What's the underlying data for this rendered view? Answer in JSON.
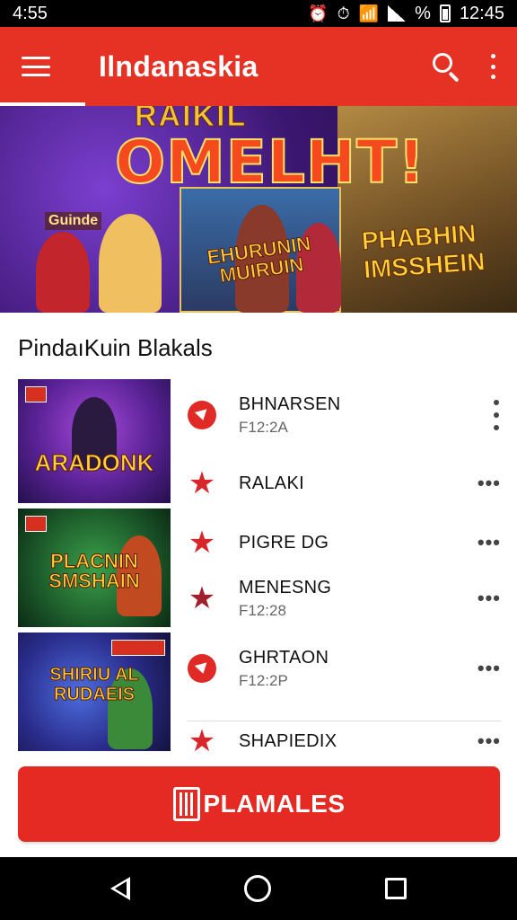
{
  "status_bar": {
    "time_left": "4:55",
    "battery_percent": "%",
    "time_right": "12:45",
    "icons": [
      "alarm-icon",
      "alarm-icon",
      "wifi-icon",
      "signal-icon",
      "battery-icon"
    ]
  },
  "app_bar": {
    "title": "Ilndanaskia",
    "menu_icon": "menu-icon",
    "search_icon": "search-icon",
    "more_icon": "more-vert-icon"
  },
  "banner": {
    "top_text": "RAIKIL",
    "title": "OMELHT!",
    "left_tag": "Guinde",
    "mid_text": "EHURUNIN\nMUIRUIN",
    "right_text": "PHABHIN\nIMSSHEIN"
  },
  "section": {
    "title": "PindaıKuin Blakals"
  },
  "thumbnails": [
    {
      "text": "ARADONK"
    },
    {
      "text": "PLACNIN\nSMSHAIN"
    },
    {
      "text": "SHIRIU AL\nRUDAEIS"
    }
  ],
  "list": [
    {
      "name": "BHNARSEN",
      "sub": "F12:2A",
      "icon": "heart-circle-icon",
      "more": "more-vert-icon"
    },
    {
      "name": "RALAKI",
      "sub": "",
      "icon": "star-icon",
      "more": "more-horiz-icon"
    },
    {
      "name": "PIGRE DG",
      "sub": "",
      "icon": "star-icon",
      "more": "more-horiz-icon"
    },
    {
      "name": "MENESNG",
      "sub": "F12:28",
      "icon": "star-icon",
      "more": "more-horiz-icon"
    },
    {
      "name": "GHRTAON",
      "sub": "F12:2P",
      "icon": "heart-circle-icon",
      "more": "more-horiz-icon"
    },
    {
      "name": "SHAPIEDIX",
      "sub": "",
      "icon": "star-icon",
      "more": "more-horiz-icon"
    }
  ],
  "cta": {
    "label": "PLAMALES",
    "icon": "filmstrip-icon"
  },
  "colors": {
    "brand_red": "#e53224",
    "button_red": "#e42a22",
    "status_black": "#000000"
  }
}
